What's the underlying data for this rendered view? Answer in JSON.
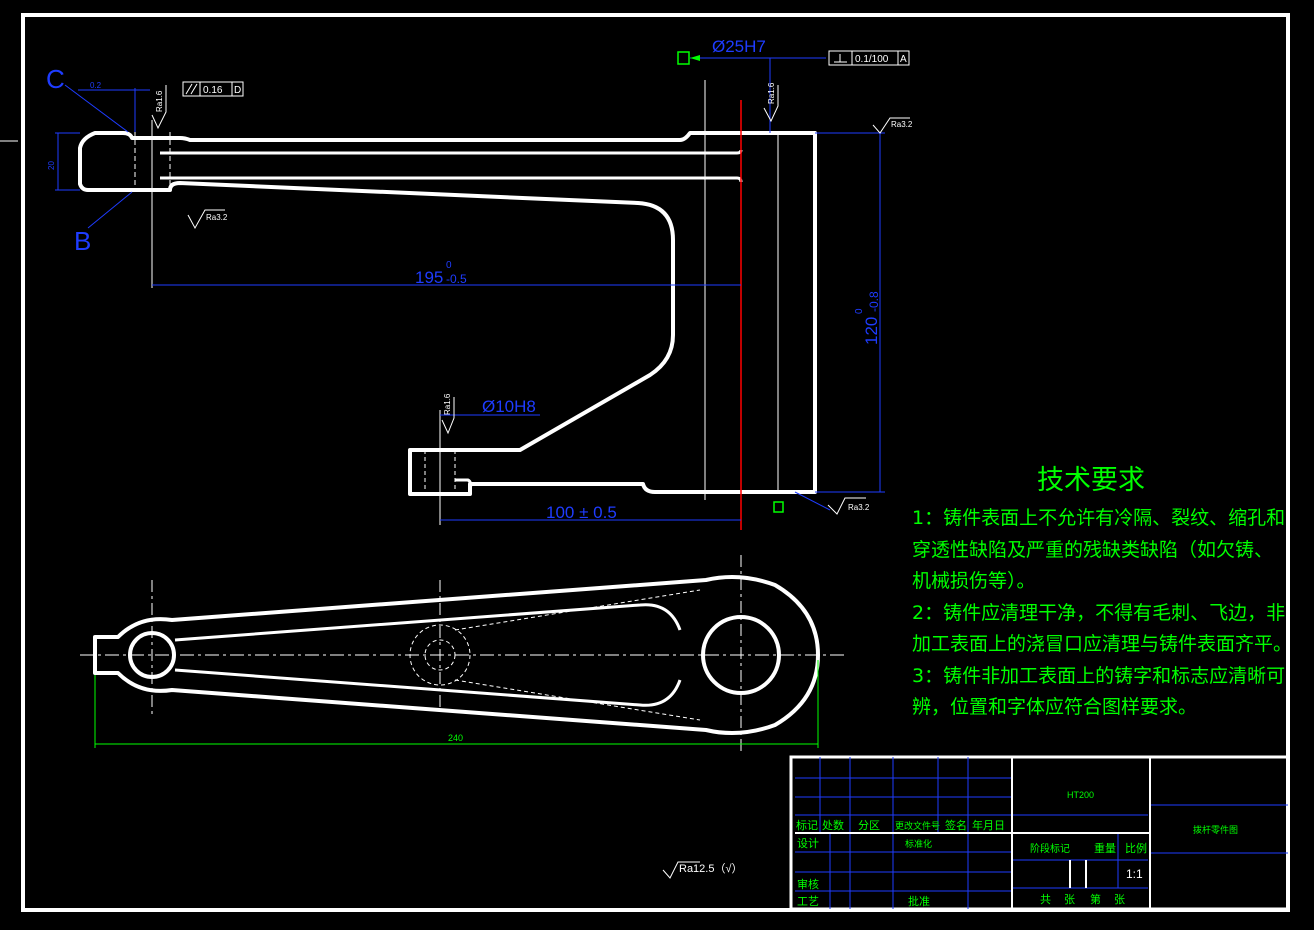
{
  "dimensions": {
    "bore_25": "Ø25H7",
    "flatness": "0.1/100",
    "datum_a": "A",
    "parallel": "0.16",
    "datum_d": "D",
    "bore_10": "Ø10H8",
    "len_195": "195",
    "tol_195_upper": "0",
    "tol_195_lower": "-0.5",
    "height_120": "120",
    "tol_120_upper": "0",
    "tol_120_lower": "-0.8",
    "len_100": "100 ± 0.5",
    "len_240": "240",
    "small_top": "0.2",
    "small_left": "20"
  },
  "views": {
    "label_c": "C",
    "label_b": "B"
  },
  "roughness": {
    "ra16": "Ra1.6",
    "ra32": "Ra3.2",
    "default": "Ra12.5（√）"
  },
  "tech_requirements": {
    "title": "技术要求",
    "lines": [
      "1：铸件表面上不允许有冷隔、裂纹、缩孔和",
      "穿透性缺陷及严重的残缺类缺陷（如欠铸、",
      "机械损伤等）。",
      "2：铸件应清理干净，不得有毛刺、飞边，非",
      "加工表面上的浇冒口应清理与铸件表面齐平。",
      "3：铸件非加工表面上的铸字和标志应清晰可",
      "辨，位置和字体应符合图样要求。"
    ]
  },
  "title_block": {
    "material": "HT200",
    "part_name": "拨杆零件图",
    "header_cells": [
      "标记",
      "处数",
      "分区",
      "更改文件号",
      "签名",
      "年月日"
    ],
    "design": "设计",
    "standardization": "标准化",
    "review": "审核",
    "process": "工艺",
    "approval": "批准",
    "stage_mark": "阶段标记",
    "weight": "重量",
    "ratio": "比例",
    "ratio_value": "1:1",
    "sheets": [
      "共",
      "张",
      "第",
      "张"
    ]
  }
}
